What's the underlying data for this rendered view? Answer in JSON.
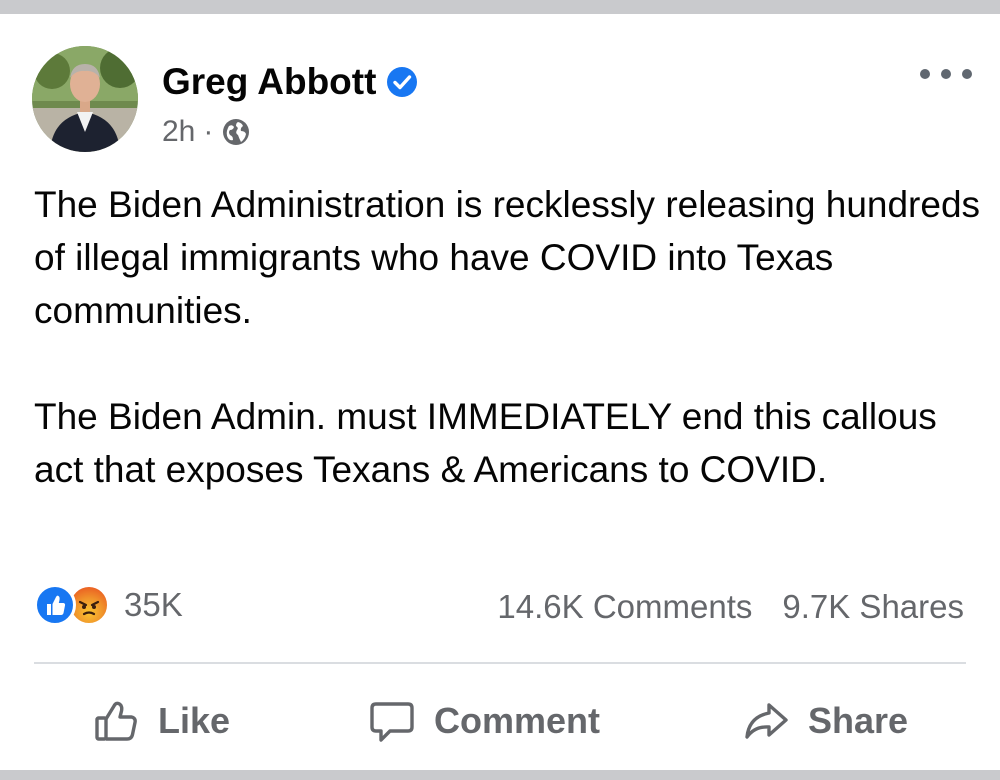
{
  "post": {
    "author": "Greg Abbott",
    "time": "2h",
    "separator": "·",
    "paragraphs": [
      "The Biden Administration is recklessly releasing hundreds of illegal immigrants who have COVID into Texas communities.",
      "The Biden Admin. must IMMEDIATELY end this callous act that exposes Texans & Americans to COVID."
    ]
  },
  "stats": {
    "reaction_count": "35K",
    "comments": "14.6K Comments",
    "shares": "9.7K Shares"
  },
  "actions": {
    "like": "Like",
    "comment": "Comment",
    "share": "Share"
  },
  "colors": {
    "brand_blue": "#1877f2",
    "text": "#050505",
    "muted": "#65676b",
    "divider": "#dadde1"
  },
  "icons": {
    "verified": "verified-badge-icon",
    "audience": "globe-icon",
    "more": "more-options-icon",
    "like_reaction": "like-reaction-icon",
    "angry_reaction": "angry-reaction-icon",
    "like": "thumbs-up-icon",
    "comment": "comment-bubble-icon",
    "share": "share-arrow-icon"
  }
}
